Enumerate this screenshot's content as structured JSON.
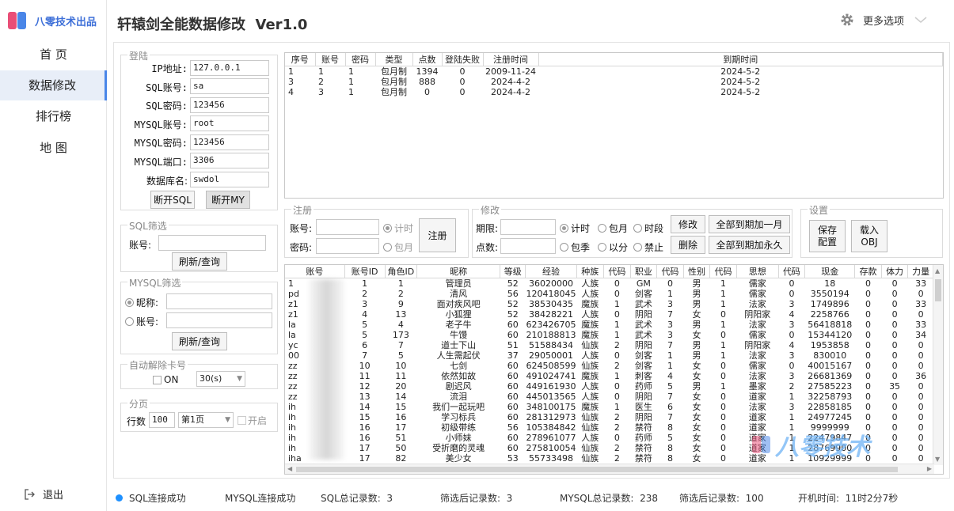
{
  "brand": {
    "name": "八零技术出品",
    "colors": [
      "#e94e77",
      "#4a86e8"
    ]
  },
  "nav": {
    "items": [
      {
        "label": "首 页"
      },
      {
        "label": "数据修改"
      },
      {
        "label": "排行榜"
      },
      {
        "label": "地 图"
      }
    ],
    "active": "数据修改",
    "logout": "退出"
  },
  "header": {
    "title": "轩辕剑全能数据修改  Ver1.0",
    "more": "更多选项",
    "more_icon": "gear-icon"
  },
  "login": {
    "title": "登陆",
    "fields": [
      {
        "label": "IP地址:",
        "value": "127.0.0.1"
      },
      {
        "label": "SQL账号:",
        "value": "sa"
      },
      {
        "label": "SQL密码:",
        "value": "123456"
      },
      {
        "label": "MYSQL账号:",
        "value": "root"
      },
      {
        "label": "MYSQL密码:",
        "value": "123456"
      },
      {
        "label": "MYSQL端口:",
        "value": "3306"
      },
      {
        "label": "数据库名:",
        "value": "swdol"
      }
    ],
    "btn_sql": "断开SQL",
    "btn_my": "断开MY"
  },
  "sql_filter": {
    "title": "SQL筛选",
    "account_label": "账号:",
    "refresh": "刷新/查询"
  },
  "mysql_filter": {
    "title": "MYSQL筛选",
    "nick_label": "昵称:",
    "account_label": "账号:",
    "refresh": "刷新/查询"
  },
  "auto_unlock": {
    "title": "自动解除卡号",
    "on_label": "ON",
    "interval": "30(s)"
  },
  "paging": {
    "title": "分页",
    "rows_label": "行数",
    "rows": "100",
    "page": "第1页",
    "enable_label": "开启"
  },
  "account_table": {
    "headers": [
      "序号",
      "账号",
      "密码",
      "类型",
      "点数",
      "登陆失败",
      "注册时间",
      "到期时间"
    ],
    "rows": [
      [
        "1",
        "1",
        "1",
        "包月制",
        "1394",
        "0",
        "2009-11-24",
        "2024-5-2"
      ],
      [
        "3",
        "2",
        "1",
        "包月制",
        "888",
        "0",
        "2024-4-2",
        "2024-5-2"
      ],
      [
        "4",
        "3",
        "1",
        "包月制",
        "0",
        "0",
        "2024-4-2",
        "2024-5-2"
      ]
    ]
  },
  "register": {
    "title": "注册",
    "account_label": "账号:",
    "password_label": "密码:",
    "opt_time": "计时",
    "opt_month": "包月",
    "button": "注册"
  },
  "modify": {
    "title": "修改",
    "term_label": "期限:",
    "points_label": "点数:",
    "opts_row1": [
      "计时",
      "包月",
      "时段"
    ],
    "opts_row2": [
      "包季",
      "以分",
      "禁止"
    ],
    "btn_modify": "修改",
    "btn_delete": "删除",
    "btn_add_month": "全部到期加一月",
    "btn_forever": "全部到期加永久"
  },
  "settings": {
    "title": "设置",
    "btn_save_l1": "保存",
    "btn_save_l2": "配置",
    "btn_load_l1": "载入",
    "btn_load_l2": "OBJ"
  },
  "char_table": {
    "headers": [
      "账号",
      "账号ID",
      "角色ID",
      "昵称",
      "等级",
      "经验",
      "种族",
      "代码",
      "职业",
      "代码",
      "性别",
      "代码",
      "思想",
      "代码",
      "现金",
      "存款",
      "体力",
      "力量"
    ],
    "rows": [
      [
        "1",
        "1",
        "1",
        "管理员",
        "52",
        "36020000",
        "人族",
        "0",
        "GM",
        "0",
        "男",
        "1",
        "儒家",
        "0",
        "18",
        "0",
        "0",
        "33"
      ],
      [
        "pd",
        "2",
        "2",
        "清风",
        "56",
        "120418045",
        "人族",
        "0",
        "剑客",
        "1",
        "男",
        "1",
        "儒家",
        "0",
        "3550194",
        "0",
        "0",
        "0"
      ],
      [
        "z1",
        "3",
        "9",
        "面对疾风吧",
        "52",
        "38530435",
        "魔族",
        "1",
        "武术",
        "3",
        "男",
        "1",
        "法家",
        "3",
        "1749896",
        "0",
        "0",
        "33"
      ],
      [
        "z1",
        "4",
        "13",
        "小狐狸",
        "52",
        "38428221",
        "人族",
        "0",
        "阴阳",
        "7",
        "女",
        "0",
        "阴阳家",
        "4",
        "2258766",
        "0",
        "0",
        "0"
      ],
      [
        "la",
        "5",
        "4",
        "老子牛",
        "60",
        "623426705",
        "魔族",
        "1",
        "武术",
        "3",
        "男",
        "1",
        "法家",
        "3",
        "56418818",
        "0",
        "0",
        "33"
      ],
      [
        "la",
        "5",
        "173",
        "牛馒",
        "60",
        "210188813",
        "魔族",
        "1",
        "武术",
        "3",
        "女",
        "0",
        "儒家",
        "0",
        "15344120",
        "0",
        "0",
        "34"
      ],
      [
        "yc",
        "6",
        "7",
        "道士下山",
        "51",
        "51588434",
        "仙族",
        "2",
        "阴阳",
        "7",
        "男",
        "1",
        "阴阳家",
        "4",
        "1953858",
        "0",
        "0",
        "0"
      ],
      [
        "00",
        "7",
        "5",
        "人生需起伏",
        "37",
        "29050001",
        "人族",
        "0",
        "剑客",
        "1",
        "男",
        "1",
        "法家",
        "3",
        "830010",
        "0",
        "0",
        "0"
      ],
      [
        "zz",
        "10",
        "10",
        "七剑",
        "60",
        "624508599",
        "仙族",
        "2",
        "剑客",
        "1",
        "女",
        "0",
        "儒家",
        "0",
        "40015167",
        "0",
        "0",
        "0"
      ],
      [
        "zz",
        "11",
        "11",
        "依然如故",
        "60",
        "491024741",
        "魔族",
        "1",
        "刺客",
        "4",
        "女",
        "0",
        "法家",
        "3",
        "26681369",
        "0",
        "0",
        "36"
      ],
      [
        "zz",
        "12",
        "20",
        "剧迟风",
        "60",
        "449161930",
        "人族",
        "0",
        "药师",
        "5",
        "男",
        "1",
        "墨家",
        "2",
        "27585223",
        "0",
        "35",
        "0"
      ],
      [
        "zz",
        "13",
        "14",
        "流泪",
        "60",
        "445013565",
        "人族",
        "0",
        "阴阳",
        "7",
        "女",
        "0",
        "道家",
        "1",
        "32258793",
        "0",
        "0",
        "0"
      ],
      [
        "ih",
        "14",
        "15",
        "我们一起玩吧",
        "60",
        "348100175",
        "魔族",
        "1",
        "医生",
        "6",
        "女",
        "0",
        "法家",
        "3",
        "22858185",
        "0",
        "0",
        "0"
      ],
      [
        "ih",
        "15",
        "16",
        "学习标兵",
        "60",
        "281312973",
        "仙族",
        "2",
        "阴阳",
        "7",
        "女",
        "0",
        "道家",
        "1",
        "24977245",
        "0",
        "0",
        "0"
      ],
      [
        "ih",
        "16",
        "17",
        "初级带练",
        "56",
        "105384842",
        "仙族",
        "2",
        "禁符",
        "8",
        "女",
        "0",
        "道家",
        "1",
        "9999999",
        "0",
        "0",
        "0"
      ],
      [
        "ih",
        "16",
        "51",
        "小师妹",
        "60",
        "278961077",
        "人族",
        "0",
        "药师",
        "5",
        "女",
        "0",
        "道家",
        "1",
        "22479847",
        "0",
        "0",
        "0"
      ],
      [
        "ih",
        "17",
        "50",
        "受折磨的灵魂",
        "60",
        "275810054",
        "仙族",
        "2",
        "禁符",
        "8",
        "女",
        "0",
        "道家",
        "1",
        "28769900",
        "0",
        "0",
        "0"
      ],
      [
        "iha",
        "17",
        "82",
        "美少女",
        "53",
        "55733498",
        "仙族",
        "2",
        "禁符",
        "8",
        "女",
        "0",
        "道家",
        "1",
        "10929999",
        "0",
        "0",
        "0"
      ]
    ]
  },
  "watermark": "八零技术",
  "status": {
    "sql": "SQL连接成功",
    "mysql": "MYSQL连接成功",
    "sql_total": "SQL总记录数:  3",
    "filtered1": "筛选后记录数:  3",
    "mysql_total": "MYSQL总记录数:  238",
    "filtered2": "筛选后记录数:  100",
    "uptime": "开机时间:  11时2分7秒",
    "dot_color": "#1e90ff"
  }
}
